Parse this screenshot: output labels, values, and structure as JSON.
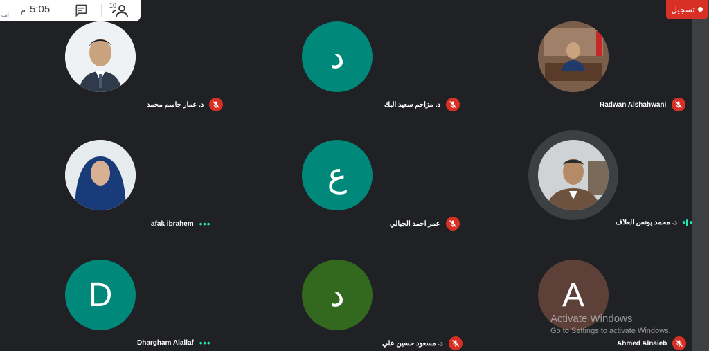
{
  "info_panel": {
    "time": "5:05",
    "ampm": "م",
    "tiny_label": "أنت",
    "participant_count": "10"
  },
  "record": {
    "label": "تسجيل"
  },
  "participants": [
    {
      "name": "د. عمار جاسم محمد",
      "status": "muted",
      "avatar": "photo",
      "color": "#cfd8dc"
    },
    {
      "name": "د. مزاحم سعيد البك",
      "status": "muted",
      "avatar_letter": "د",
      "color": "#00897b"
    },
    {
      "name": "Radwan Alshahwani",
      "status": "muted",
      "avatar": "photo",
      "color": "#8d6e63"
    },
    {
      "name": "afak ibrahem",
      "status": "more",
      "avatar": "photo",
      "color": "#eceff1"
    },
    {
      "name": "عمر احمد الجبالي",
      "status": "muted",
      "avatar_letter": "ع",
      "color": "#00897b"
    },
    {
      "name": "د. محمد يونس العلاف",
      "status": "speaking",
      "avatar": "photo",
      "color": "#90a4ae"
    },
    {
      "name": "Dhargham Alallaf",
      "status": "more",
      "avatar_letter": "D",
      "color": "#00897b"
    },
    {
      "name": "د. مسعود حسين علي",
      "status": "muted",
      "avatar_letter": "د",
      "color": "#33691e"
    },
    {
      "name": "Ahmed Alnaieb",
      "status": "muted",
      "avatar_letter": "A",
      "color": "#5d4037"
    }
  ],
  "watermark": {
    "title": "Activate Windows",
    "subtitle": "Go to Settings to activate Windows."
  }
}
